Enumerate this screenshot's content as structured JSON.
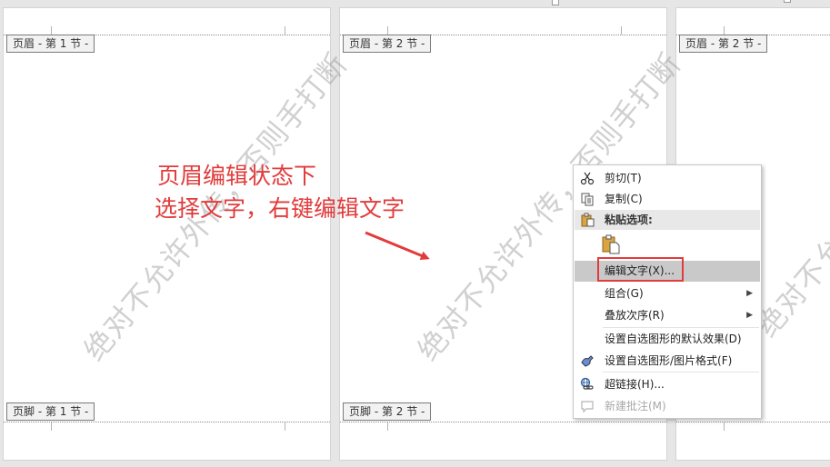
{
  "pages": [
    {
      "header_tag": "页眉 - 第 1 节 -",
      "footer_tag": "页脚 - 第 1 节 -"
    },
    {
      "header_tag": "页眉 - 第 2 节 -",
      "footer_tag": "页脚 - 第 2 节 -"
    },
    {
      "header_tag": "页眉 - 第 2 节 -"
    }
  ],
  "watermark": "绝对不允许外传，否则手打断",
  "annotation": {
    "line1": "页眉编辑状态下",
    "line2": "选择文字，右键编辑文字",
    "color": "#e23b3b"
  },
  "context_menu": {
    "cut": "剪切(T)",
    "copy": "复制(C)",
    "paste_options": "粘贴选项:",
    "edit_text": "编辑文字(X)...",
    "group": "组合(G)",
    "order": "叠放次序(R)",
    "set_default": "设置自选图形的默认效果(D)",
    "format_shape": "设置自选图形/图片格式(F)",
    "hyperlink": "超链接(H)...",
    "new_comment": "新建批注(M)"
  },
  "colors": {
    "highlight": "#c9c9c9",
    "section": "#e8e8e8",
    "annotation_red": "#e23b3b"
  }
}
